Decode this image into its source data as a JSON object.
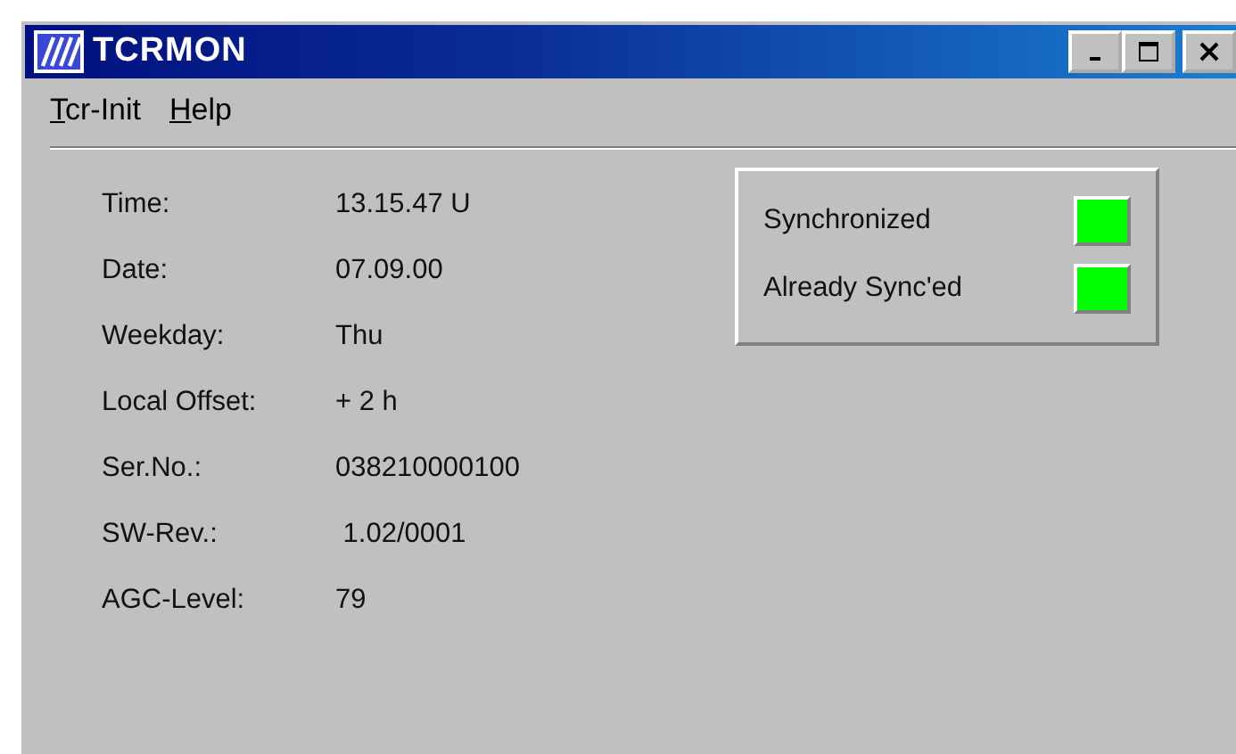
{
  "window": {
    "title": "TCRMON"
  },
  "menu": [
    {
      "accel": "T",
      "rest": "cr-Init"
    },
    {
      "accel": "H",
      "rest": "elp"
    }
  ],
  "fields": [
    {
      "label": "Time:",
      "value": "13.15.47 U"
    },
    {
      "label": "Date:",
      "value": "07.09.00"
    },
    {
      "label": "Weekday:",
      "value": "Thu"
    },
    {
      "label": "Local Offset:",
      "value": "+ 2 h"
    },
    {
      "label": "Ser.No.:",
      "value": "038210000100"
    },
    {
      "label": "SW-Rev.:",
      "value": " 1.02/0001"
    },
    {
      "label": "AGC-Level:",
      "value": "79"
    }
  ],
  "indicators": [
    {
      "label": "Synchronized",
      "color": "#00ff00"
    },
    {
      "label": "Already Sync'ed",
      "color": "#00ff00"
    }
  ]
}
